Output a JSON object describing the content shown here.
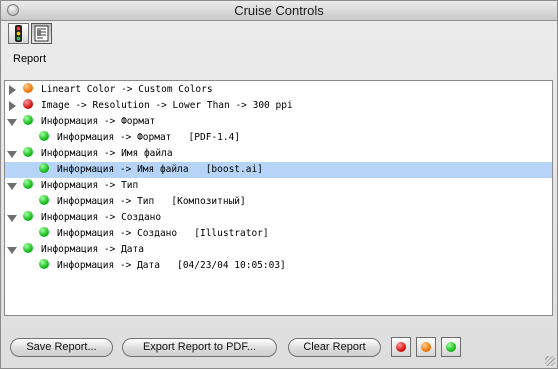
{
  "window": {
    "title": "Cruise Controls"
  },
  "toolbar": {
    "report_label": "Report"
  },
  "tree": [
    {
      "text": "Lineart Color -> Custom Colors",
      "status": "orange",
      "level": 0,
      "expander": "right"
    },
    {
      "text": "Image -> Resolution -> Lower Than -> 300 ppi",
      "status": "red",
      "level": 0,
      "expander": "right"
    },
    {
      "text": "Информация -> Формат",
      "status": "green",
      "level": 0,
      "expander": "down"
    },
    {
      "text": "Информация -> Формат   [PDF-1.4]",
      "status": "green",
      "level": 1,
      "expander": ""
    },
    {
      "text": "Информация -> Имя файла",
      "status": "green",
      "level": 0,
      "expander": "down"
    },
    {
      "text": "Информация -> Имя файла   [boost.ai]",
      "status": "green",
      "level": 1,
      "expander": "",
      "selected": true
    },
    {
      "text": "Информация -> Тип",
      "status": "green",
      "level": 0,
      "expander": "down"
    },
    {
      "text": "Информация -> Тип   [Композитный]",
      "status": "green",
      "level": 1,
      "expander": ""
    },
    {
      "text": "Информация -> Создано",
      "status": "green",
      "level": 0,
      "expander": "down"
    },
    {
      "text": "Информация -> Создано   [Illustrator]",
      "status": "green",
      "level": 1,
      "expander": ""
    },
    {
      "text": "Информация -> Дата",
      "status": "green",
      "level": 0,
      "expander": "down"
    },
    {
      "text": "Информация -> Дата   [04/23/04 10:05:03]",
      "status": "green",
      "level": 1,
      "expander": ""
    }
  ],
  "buttons": {
    "save": "Save Report...",
    "export": "Export Report to PDF...",
    "clear": "Clear Report"
  },
  "filters": [
    {
      "name": "red",
      "color": "#d51414"
    },
    {
      "name": "orange",
      "color": "#f07a10"
    },
    {
      "name": "green",
      "color": "#1cbc1c"
    }
  ]
}
